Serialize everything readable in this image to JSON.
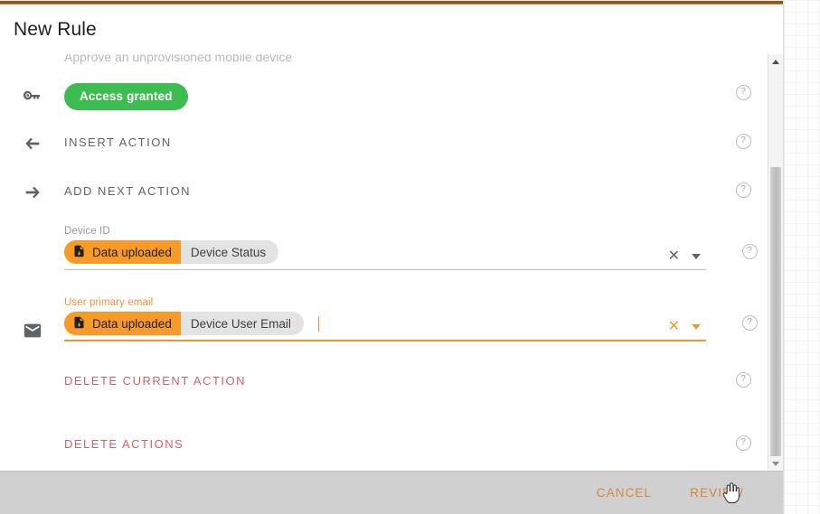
{
  "window": {
    "title": "New Rule",
    "clipped_subtitle": "Approve an unprovisioned mobile device"
  },
  "colors": {
    "accent_orange": "#f79a28",
    "footer_orange": "#d4883a",
    "success_green": "#3dbd4f",
    "danger_red": "#d4606a",
    "chip_gray": "#e3e3e3",
    "footer_bg": "#d0d0d0"
  },
  "rows": {
    "access": {
      "icon": "key-icon",
      "badge": "Access granted",
      "help": "?"
    },
    "insert_action": {
      "icon": "arrow-left-icon",
      "label": "INSERT ACTION",
      "help": "?"
    },
    "add_next_action": {
      "icon": "arrow-right-icon",
      "label": "ADD NEXT ACTION",
      "help": "?"
    },
    "delete_current_action": {
      "label": "DELETE CURRENT ACTION",
      "help": "?"
    },
    "delete_actions": {
      "label": "DELETE ACTIONS",
      "help": "?"
    }
  },
  "fields": [
    {
      "name": "device-id",
      "label": "Device ID",
      "chip_source": "Data uploaded",
      "chip_value": "Device Status",
      "chip_icon": "file-upload-icon",
      "clear_icon": "close-icon",
      "dropdown_icon": "triangle-down-icon",
      "help": "?",
      "focused": false
    },
    {
      "name": "user-primary-email",
      "label": "User primary email",
      "chip_source": "Data uploaded",
      "chip_value": "Device User Email",
      "chip_icon": "file-upload-icon",
      "clear_icon": "close-icon",
      "dropdown_icon": "triangle-down-icon",
      "help": "?",
      "focused": true
    }
  ],
  "scrollbar": {
    "up_arrow": "triangle-up-icon",
    "down_arrow": "triangle-down-icon"
  },
  "footer": {
    "cancel_label": "CANCEL",
    "review_label": "REVIEW"
  }
}
